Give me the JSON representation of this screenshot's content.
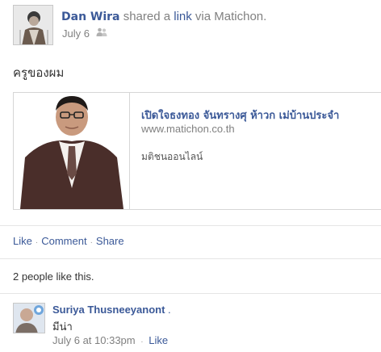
{
  "post": {
    "author": "Dan Wira",
    "action_text": "shared a",
    "link_word": "link",
    "via_text": "via Matichon.",
    "date": "July 6",
    "privacy_icon": "friends-icon",
    "message": "ครูของผม"
  },
  "shared_link": {
    "title": "เปิดใจธงทอง จันทรางศุ ห้าวก เม่บ้านประจำ",
    "url": "www.matichon.co.th",
    "description": "มติชนออนไลน์"
  },
  "actions": {
    "like": "Like",
    "comment": "Comment",
    "share": "Share"
  },
  "likes_summary": "2 people like this.",
  "comment": {
    "author": "Suriya Thusneeyanont",
    "text": "มีน่า",
    "timestamp": "July 6 at 10:33pm",
    "like": "Like"
  },
  "colors": {
    "link_blue": "#3b5998",
    "meta_gray": "#808080",
    "border": "#d6d6d6"
  }
}
